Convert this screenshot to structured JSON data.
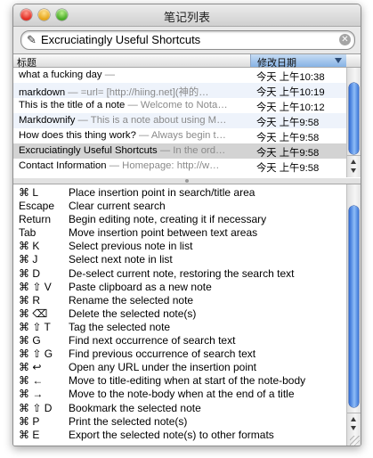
{
  "window": {
    "title": "笔记列表"
  },
  "search": {
    "value": "Excruciatingly Useful Shortcuts",
    "icon": "pencil-icon"
  },
  "list": {
    "columns": {
      "title": "标题",
      "date": "修改日期"
    },
    "rows": [
      {
        "title": "what a fucking day",
        "preview": " —",
        "date": "今天  上午10:38"
      },
      {
        "title": "markdown",
        "preview": " — =url=  [http://hiing.net](神的…",
        "date": "今天  上午10:19"
      },
      {
        "title": "This is the title of a note",
        "preview": " — Welcome to Nota…",
        "date": "今天  上午10:12"
      },
      {
        "title": "Markdownify",
        "preview": " — This is a note about using M…",
        "date": "今天  上午9:58"
      },
      {
        "title": "How does this thing work?",
        "preview": " — Always begin t…",
        "date": "今天  上午9:58"
      },
      {
        "title": "Excruciatingly Useful Shortcuts",
        "preview": " — In the ord…",
        "date": "今天  上午9:58"
      },
      {
        "title": "Contact Information",
        "preview": " — Homepage:  http://w…",
        "date": "今天  上午9:58"
      }
    ]
  },
  "shortcuts": [
    {
      "key": "⌘ L",
      "desc": "Place insertion point in search/title area"
    },
    {
      "key": "Escape",
      "desc": "Clear current search"
    },
    {
      "key": "Return",
      "desc": "Begin editing note, creating it if necessary"
    },
    {
      "key": "Tab",
      "desc": "Move insertion point between text areas"
    },
    {
      "key": "⌘ K",
      "desc": "Select previous note in list"
    },
    {
      "key": "⌘ J",
      "desc": "Select next note in list"
    },
    {
      "key": "⌘ D",
      "desc": "De-select current note, restoring the search text"
    },
    {
      "key": "⌘ ⇧ V",
      "desc": "Paste clipboard as a new note"
    },
    {
      "key": "⌘ R",
      "desc": "Rename the selected note"
    },
    {
      "key": "⌘ ⌫",
      "desc": "Delete the selected note(s)"
    },
    {
      "key": "⌘ ⇧ T",
      "desc": "Tag the selected note"
    },
    {
      "key": "⌘ G",
      "desc": "Find next occurrence of search text"
    },
    {
      "key": "⌘ ⇧ G",
      "desc": "Find previous occurrence of search text"
    },
    {
      "key": "⌘ ↩",
      "desc": "Open any URL under the insertion point"
    },
    {
      "key": "⌘ ←",
      "desc": "Move to title-editing when at start of the note-body"
    },
    {
      "key": "⌘ →",
      "desc": "Move to the note-body when at the end of a title"
    },
    {
      "key": "⌘ ⇧ D",
      "desc": "Bookmark the selected note"
    },
    {
      "key": "⌘ P",
      "desc": "Print the selected note(s)"
    },
    {
      "key": "⌘ E",
      "desc": "Export the selected note(s) to other formats"
    }
  ]
}
